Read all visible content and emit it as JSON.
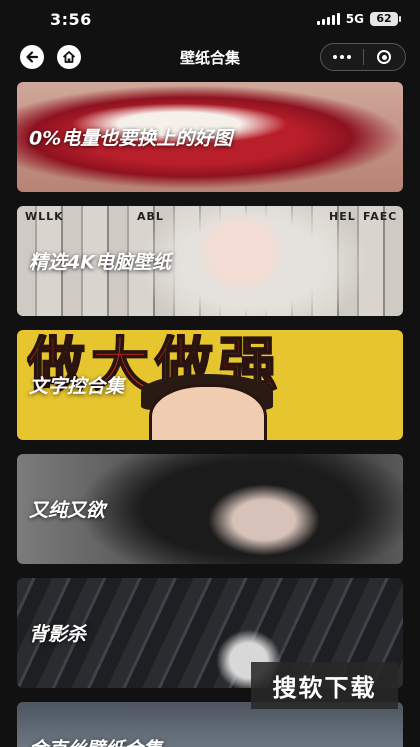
{
  "status_bar": {
    "time": "3:56",
    "network": "5G",
    "battery": "62"
  },
  "nav": {
    "title": "壁纸合集",
    "back_icon": "back-arrow-icon",
    "home_icon": "home-icon",
    "more_icon": "more-dots-icon",
    "close_icon": "record-circle-icon"
  },
  "cards": [
    {
      "label": "0%电量也要换上的好图"
    },
    {
      "label": "精选4K电脑壁纸",
      "paper_words": [
        "WLLK",
        "ABL",
        "HEL",
        "FAEC"
      ]
    },
    {
      "label": "文字控合集",
      "banner_text": "做大做强"
    },
    {
      "label": "又纯又欲"
    },
    {
      "label": "背影杀"
    },
    {
      "label": "金克丝壁纸合集"
    }
  ],
  "watermark": "搜软下载",
  "colors": {
    "background": "#111111",
    "banner_red": "#d92a1f",
    "banner_yellow": "#e6c52e"
  }
}
